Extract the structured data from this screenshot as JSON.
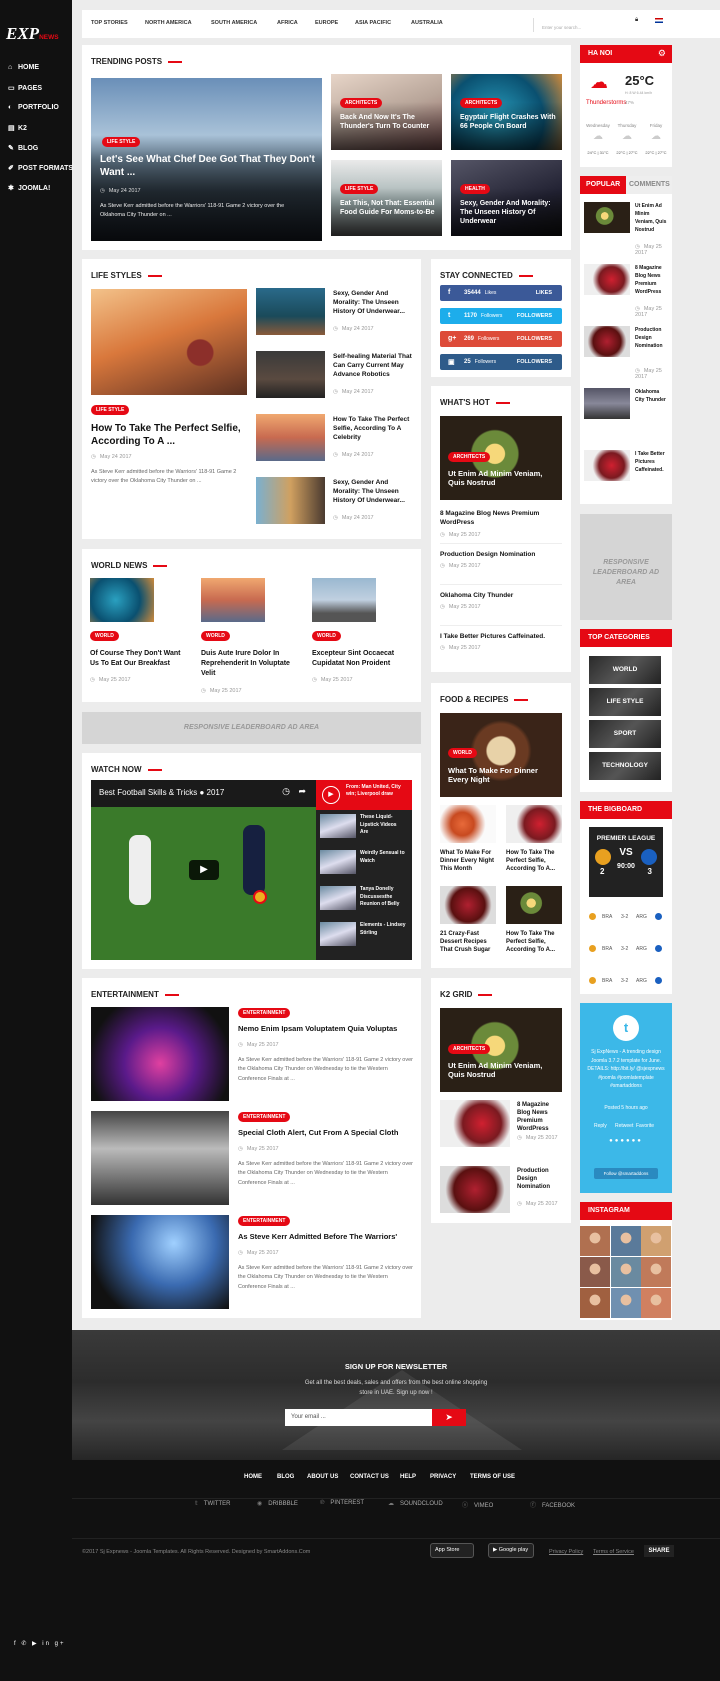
{
  "logo": {
    "text": "EXP",
    "news": "NEWS"
  },
  "sidebar": {
    "items": [
      {
        "icon": "home-icon",
        "glyph": "⌂",
        "label": "HOME"
      },
      {
        "icon": "pages-icon",
        "glyph": "▭",
        "label": "PAGES"
      },
      {
        "icon": "portfolio-icon",
        "glyph": "◐",
        "label": "PORTFOLIO"
      },
      {
        "icon": "k2-icon",
        "glyph": "▤",
        "label": "K2"
      },
      {
        "icon": "blog-icon",
        "glyph": "✎",
        "label": "BLOG"
      },
      {
        "icon": "post-formats-icon",
        "glyph": "✐",
        "label": "POST FORMATS"
      },
      {
        "icon": "joomla-icon",
        "glyph": "✱",
        "label": "JOOMLA!"
      }
    ],
    "social": "f ✆ ▶ in g+"
  },
  "topnav": {
    "items": [
      "TOP STORIES",
      "NORTH AMERICA",
      "SOUTH AMERICA",
      "AFRICA",
      "EUROPE",
      "ASIA PACIFIC",
      "AUSTRALIA"
    ],
    "search_placeholder": "Enter your search..."
  },
  "trending": {
    "title": "TRENDING POSTS",
    "main": {
      "tag": "LIFE STYLE",
      "title": "Let's See What Chef Dee Got That They Don't Want ...",
      "date": "May 24 2017",
      "excerpt": "As Steve Kerr admitted before the Warriors' 118-91 Game 2 victory over the Oklahoma City Thunder on ..."
    },
    "cards": [
      {
        "tag": "ARCHITECTS",
        "title": "Back And Now It's The Thunder's Turn To Counter"
      },
      {
        "tag": "ARCHITECTS",
        "title": "Egyptair Flight Crashes With 66 People On Board"
      },
      {
        "tag": "LIFE STYLE",
        "title": "Eat This, Not That: Essential Food Guide For Moms-to-Be"
      },
      {
        "tag": "HEALTH",
        "title": "Sexy, Gender And Morality: The Unseen History Of Underwear"
      }
    ]
  },
  "lifestyles": {
    "title": "LIFE STYLES",
    "main": {
      "tag": "LIFE STYLE",
      "title": "How To Take The Perfect Selfie, According To A ...",
      "date": "May 24 2017",
      "excerpt": "As Steve Kerr admitted before the Warriors' 118-91 Game 2 victory over the Oklahoma City Thunder on ..."
    },
    "items": [
      {
        "title": "Sexy, Gender And Morality: The Unseen History Of Underwear...",
        "date": "May 24 2017"
      },
      {
        "title": "Self-healing Material That Can Carry Current May Advance Robotics",
        "date": "May 24 2017"
      },
      {
        "title": "How To Take The Perfect Selfie, According To A Celebrity",
        "date": "May 24 2017"
      },
      {
        "title": "Sexy, Gender And Morality: The Unseen History Of Underwear...",
        "date": "May 24 2017"
      }
    ]
  },
  "world": {
    "title": "WORLD NEWS",
    "items": [
      {
        "tag": "WORLD",
        "title": "Of Course They Don't Want Us To Eat Our Breakfast",
        "date": "May 25 2017"
      },
      {
        "tag": "WORLD",
        "title": "Duis Aute Irure Dolor In Reprehenderit In Voluptate Velit",
        "date": "May 25 2017"
      },
      {
        "tag": "WORLD",
        "title": "Excepteur Sint Occaecat Cupidatat Non Proident",
        "date": "May 25 2017"
      }
    ]
  },
  "ad_leaderboard": "RESPONSIVE LEADERBOARD AD AREA",
  "watch": {
    "title": "WATCH NOW",
    "video_title": "Best Football Skills & Tricks ● 2017",
    "playlist": [
      {
        "title": "From: Man United, City win; Liverpool draw"
      },
      {
        "title": "These Liquid-Lipstick Videos Are"
      },
      {
        "title": "Weirdly Sensual to Watch"
      },
      {
        "title": "Tanya Donelly Discussesthe Reunion of Belly"
      },
      {
        "title": "Elements - Lindsey Stirling"
      }
    ]
  },
  "entertainment": {
    "title": "ENTERTAINMENT",
    "items": [
      {
        "tag": "ENTERTAINMENT",
        "title": "Nemo Enim Ipsam Voluptatem Quia Voluptas",
        "date": "May 25 2017",
        "excerpt": "As Steve Kerr admitted before the Warriors' 118-91 Game 2 victory over the Oklahoma City Thunder on Wednesday to tie the Western Conference Finals at ..."
      },
      {
        "tag": "ENTERTAINMENT",
        "title": "Special Cloth Alert, Cut From A Special Cloth",
        "date": "May 25 2017",
        "excerpt": "As Steve Kerr admitted before the Warriors' 118-91 Game 2 victory over the Oklahoma City Thunder on Wednesday to tie the Western Conference Finals at ..."
      },
      {
        "tag": "ENTERTAINMENT",
        "title": "As Steve Kerr Admitted Before The Warriors'",
        "date": "May 25 2017",
        "excerpt": "As Steve Kerr admitted before the Warriors' 118-91 Game 2 victory over the Oklahoma City Thunder on Wednesday to tie the Western Conference Finals at ..."
      }
    ]
  },
  "connected": {
    "title": "STAY CONNECTED",
    "items": [
      {
        "count": "35444",
        "unit": "Likes",
        "action": "LIKES",
        "color": "#3b5998",
        "icon": "f"
      },
      {
        "count": "1170",
        "unit": "Followers",
        "action": "FOLLOWERS",
        "color": "#1dadeb",
        "icon": "t"
      },
      {
        "count": "269",
        "unit": "Followers",
        "action": "FOLLOWERS",
        "color": "#dd4b39",
        "icon": "g+"
      },
      {
        "count": "25",
        "unit": "Followers",
        "action": "FOLLOWERS",
        "color": "#2e5b8a",
        "icon": "▣"
      }
    ]
  },
  "whatshot": {
    "title": "WHAT'S HOT",
    "main": {
      "tag": "ARCHITECTS",
      "title": "Ut Enim Ad Minim Veniam, Quis Nostrud"
    },
    "items": [
      {
        "title": "8 Magazine Blog News Premium WordPress",
        "date": "May 25 2017"
      },
      {
        "title": "Production Design Nomination",
        "date": "May 25 2017"
      },
      {
        "title": "Oklahoma City Thunder",
        "date": "May 25 2017"
      },
      {
        "title": "I Take Better Pictures Caffeinated.",
        "date": "May 25 2017"
      }
    ]
  },
  "food": {
    "title": "FOOD & RECIPES",
    "main": {
      "tag": "WORLD",
      "title": "What To Make For Dinner Every Night"
    },
    "items": [
      {
        "title": "What To Make For Dinner Every Night This Month"
      },
      {
        "title": "How To Take The Perfect Selfie, According To A..."
      },
      {
        "title": "21 Crazy-Fast Dessert Recipes That Crush Sugar"
      },
      {
        "title": "How To Take The Perfect Selfie, According To A..."
      }
    ]
  },
  "k2grid": {
    "title": "K2 GRID",
    "main": {
      "tag": "ARCHITECTS",
      "title": "Ut Enim Ad Minim Veniam, Quis Nostrud"
    },
    "items": [
      {
        "title": "8 Magazine Blog News Premium WordPress",
        "date": "May 25 2017"
      },
      {
        "title": "Production Design Nomination",
        "date": "May 25 2017"
      }
    ]
  },
  "weather": {
    "city": "HA NOI",
    "temp": "25°C",
    "cond": "Thunderstorms",
    "detail": "H: 8 W 6.44 km/h",
    "hum": "47%",
    "days": [
      "Wednesday",
      "Thursday",
      "Friday"
    ],
    "temps": [
      "24°C | 31°C",
      "22°C | 27°C",
      "22°C | 27°C"
    ]
  },
  "popular": {
    "tab1": "POPULAR",
    "tab2": "COMMENTS",
    "items": [
      {
        "title": "Ut Enim Ad Minim Veniam, Quis Nostrud",
        "date": "May 25 2017"
      },
      {
        "title": "8 Magazine Blog News Premium WordPress",
        "date": "May 25 2017"
      },
      {
        "title": "Production Design Nomination",
        "date": "May 25 2017"
      },
      {
        "title": "Oklahoma City Thunder",
        "date": "May 25 2017"
      },
      {
        "title": "I Take Better Pictures Caffeinated.",
        "date": "May 25 2017"
      }
    ]
  },
  "ad_side": "RESPONSIVE LEADERBOARD AD AREA",
  "topcats": {
    "title": "TOP CATEGORIES",
    "items": [
      "WORLD",
      "LIFE STYLE",
      "SPORT",
      "TECHNOLOGY"
    ]
  },
  "bigboard": {
    "title": "THE BIGBOARD",
    "league": "PREMIER LEAGUE",
    "vs": "VS",
    "time": "90:00",
    "score1": "2",
    "score2": "3",
    "rows": [
      {
        "a": "BRA",
        "s": "3-2",
        "b": "ARG"
      },
      {
        "a": "BRA",
        "s": "3-2",
        "b": "ARG"
      },
      {
        "a": "BRA",
        "s": "3-2",
        "b": "ARG"
      }
    ]
  },
  "twitter": {
    "text": "Sj ExpNews - A trending design Joomla 3.7.2 template for June. DETAILS: http://bit.ly/ @sjexpnews #joomla #joomlatemplate #smartaddons",
    "time": "Posted 5 hours ago",
    "actions": [
      "Reply",
      "Retweet",
      "Favorite"
    ],
    "follow": "Follow @smartaddons"
  },
  "instagram": {
    "title": "INSTAGRAM"
  },
  "newsletter": {
    "title": "SIGN UP FOR NEWSLETTER",
    "text": "Get all the best deals, sales and offers from the best online shopping store in UAE. Sign up now !",
    "placeholder": "Your email ..."
  },
  "footer": {
    "links": [
      "HOME",
      "BLOG",
      "ABOUT US",
      "CONTACT US",
      "HELP",
      "PRIVACY",
      "TERMS OF USE"
    ],
    "social": [
      "TWITTER",
      "DRIBBBLE",
      "PINTEREST",
      "SOUNDCLOUD",
      "VIMEO",
      "FACEBOOK"
    ],
    "copyright": "©2017 Sj Expnews - Joomla Templates. All Rights Reserved. Designed by SmartAddons.Com",
    "appstore": "App Store",
    "googleplay": "Google play",
    "privacy": "Privacy Policy",
    "terms": "Terms of Service",
    "share": "SHARE"
  },
  "colors": {
    "accent": "#e50914",
    "sidebar": "#111111"
  }
}
